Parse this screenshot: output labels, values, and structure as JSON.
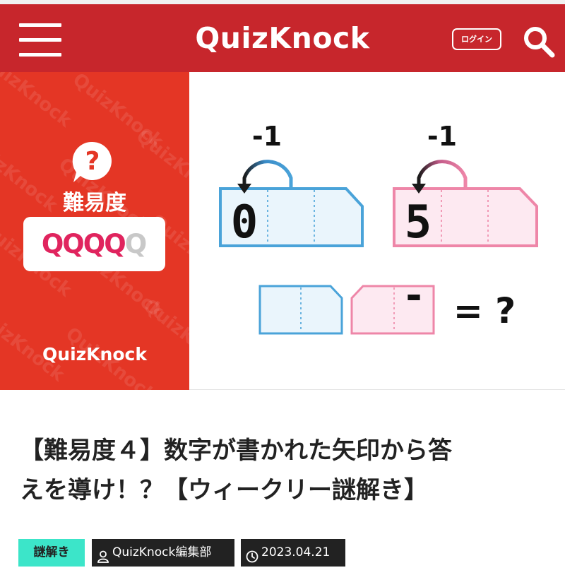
{
  "header": {
    "logo": "QuizKnock",
    "login_label": "ログイン"
  },
  "hero": {
    "difficulty_label": "難易度",
    "rating": {
      "letter": "Q",
      "filled": 4,
      "total": 5
    },
    "brand": "QuizKnock",
    "watermark_text": "QuizKnock",
    "puzzle": {
      "top_left": {
        "step": "-1",
        "digit": "0"
      },
      "top_right": {
        "step": "-1",
        "digit": "5"
      },
      "bottom_right_digit": "-",
      "equation": "= ?"
    },
    "colors": {
      "blue": "#4aa3d9",
      "blue_fill": "#eaf5fc",
      "pink": "#ee86a8",
      "pink_fill": "#fde9f1",
      "rating_on": "#e0245e",
      "rating_off": "#c8c8c8"
    }
  },
  "article": {
    "title_line1": "【難易度４】数字が書かれた矢印から答",
    "title_line2": "えを導け！？【ウィークリー謎解き】",
    "category": "謎解き",
    "author": "QuizKnock編集部",
    "date": "2023.04.21"
  }
}
